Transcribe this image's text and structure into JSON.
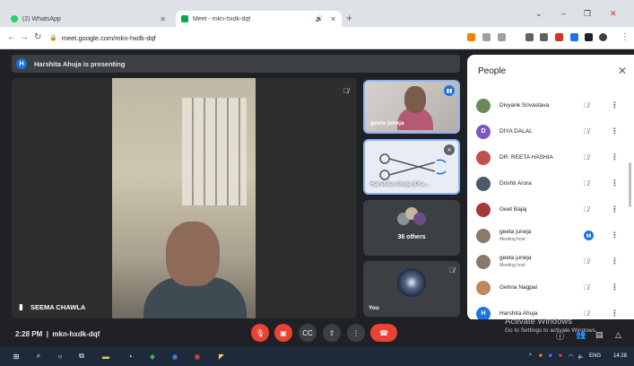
{
  "browser": {
    "tabs": [
      {
        "label": "(2) WhatsApp",
        "active": false
      },
      {
        "label": "Meet - mkn-hxdk-dqf",
        "active": true
      }
    ],
    "new_tab": "+",
    "url": "meet.google.com/mkn-hxdk-dqf"
  },
  "meet": {
    "presenting_banner": "Harshita Ahuja is presenting",
    "presenter_initial": "H",
    "main_speaker": "SEEMA CHAWLA",
    "tiles": {
      "geeta": "geeta juneja",
      "presentation": "Harshita Ahuja (Pre...",
      "others": "36 others",
      "you": "You"
    },
    "meeting_time": "2:28 PM",
    "meeting_code": "mkn-hxdk-dqf",
    "separator": "|"
  },
  "people_panel": {
    "title": "People",
    "participants": [
      {
        "name": "Divyank Srivastava",
        "sub": "",
        "initial": "",
        "avatar_color": "#6b8a5a",
        "speaking": false
      },
      {
        "name": "DIYA DALAL",
        "sub": "",
        "initial": "D",
        "avatar_color": "#7e57c2",
        "speaking": false
      },
      {
        "name": "DR. REETA HASHIA",
        "sub": "",
        "initial": "",
        "avatar_color": "#c0504d",
        "speaking": false
      },
      {
        "name": "Drishti Arora",
        "sub": "",
        "initial": "",
        "avatar_color": "#4a5a6a",
        "speaking": false
      },
      {
        "name": "Geet Bajaj",
        "sub": "",
        "initial": "",
        "avatar_color": "#a33a3a",
        "speaking": false
      },
      {
        "name": "geeta juneja",
        "sub": "Meeting host",
        "initial": "",
        "avatar_color": "#8a7a6a",
        "speaking": true
      },
      {
        "name": "geeta juneja",
        "sub": "Meeting host",
        "initial": "",
        "avatar_color": "#8a7a6a",
        "speaking": false
      },
      {
        "name": "Gehna Nagpal",
        "sub": "",
        "initial": "",
        "avatar_color": "#b98a5a",
        "speaking": false
      },
      {
        "name": "Harshita Ahuja",
        "sub": "",
        "initial": "H",
        "avatar_color": "#1a73e8",
        "speaking": false
      }
    ]
  },
  "watermark": {
    "line1": "Activate Windows",
    "line2": "Go to Settings to activate Windows."
  },
  "taskbar": {
    "language": "ENG",
    "time": "14:28"
  },
  "colors": {
    "accent": "#1a73e8",
    "danger": "#ea4335",
    "surface": "#202124"
  }
}
